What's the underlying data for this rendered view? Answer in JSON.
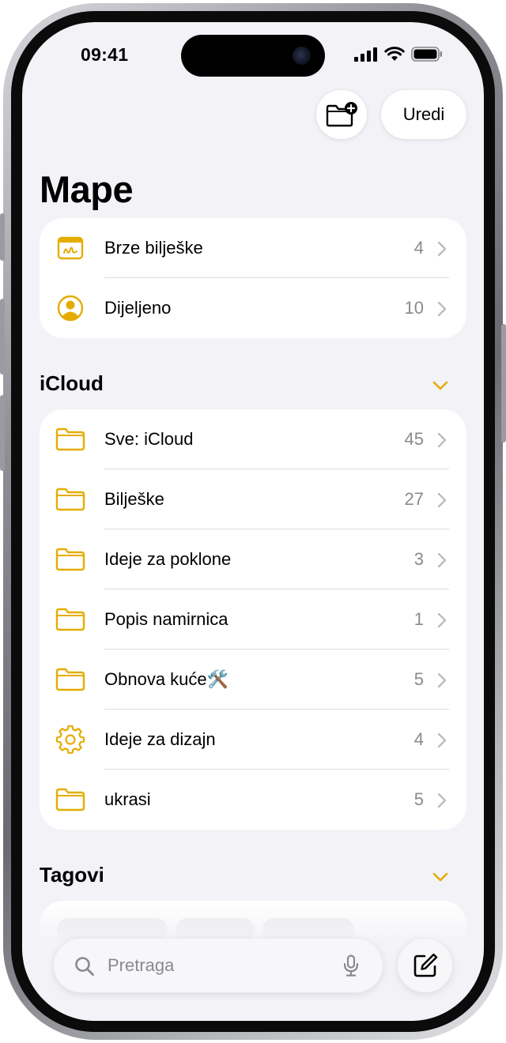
{
  "status_bar": {
    "time": "09:41"
  },
  "header": {
    "title": "Mape",
    "edit_label": "Uredi"
  },
  "pinned_folders": [
    {
      "label": "Brze bilješke",
      "count": "4",
      "icon": "quick-note-icon"
    },
    {
      "label": "Dijeljeno",
      "count": "10",
      "icon": "shared-person-icon"
    }
  ],
  "icloud": {
    "title": "iCloud",
    "folders": [
      {
        "label": "Sve: iCloud",
        "count": "45",
        "icon": "folder-icon"
      },
      {
        "label": "Bilješke",
        "count": "27",
        "icon": "folder-icon"
      },
      {
        "label": "Ideje za poklone",
        "count": "3",
        "icon": "folder-icon"
      },
      {
        "label": "Popis namirnica",
        "count": "1",
        "icon": "folder-icon"
      },
      {
        "label": "Obnova kuće🛠️",
        "count": "5",
        "icon": "folder-icon"
      },
      {
        "label": "Ideje za dizajn",
        "count": "4",
        "icon": "gear-icon"
      },
      {
        "label": "ukrasi",
        "count": "5",
        "icon": "folder-icon"
      }
    ]
  },
  "tags": {
    "title": "Tagovi"
  },
  "search": {
    "placeholder": "Pretraga"
  },
  "colors": {
    "accent": "#E5AC00",
    "background": "#F2F2F7",
    "secondary_text": "#8A8A8E"
  }
}
